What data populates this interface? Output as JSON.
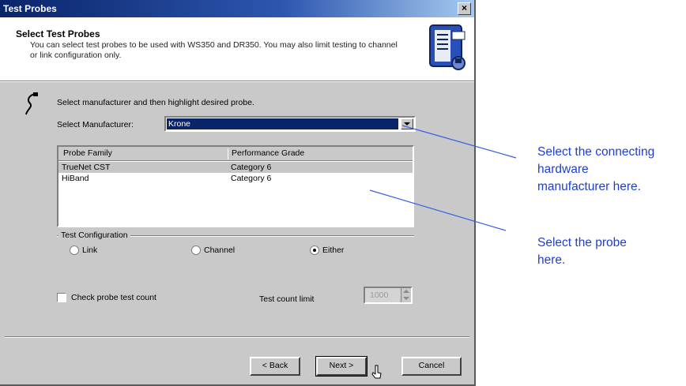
{
  "window": {
    "title": "Test Probes"
  },
  "header": {
    "title": "Select Test Probes",
    "description": "You can select test probes to be used with WS350 and DR350. You may also limit testing to channel or link configuration only."
  },
  "instruction": "Select manufacturer and then highlight desired probe.",
  "manufacturer": {
    "label": "Select Manufacturer:",
    "value": "Krone"
  },
  "probe_list": {
    "columns": [
      "Probe Family",
      "Performance Grade"
    ],
    "rows": [
      {
        "family": "TrueNet CST",
        "grade": "Category 6",
        "selected": true
      },
      {
        "family": "HiBand",
        "grade": "Category 6",
        "selected": false
      }
    ]
  },
  "test_configuration": {
    "label": "Test Configuration",
    "options": [
      {
        "label": "Link",
        "selected": false
      },
      {
        "label": "Channel",
        "selected": false
      },
      {
        "label": "Either",
        "selected": true
      }
    ]
  },
  "probe_count": {
    "checkbox_label": "Check probe test count",
    "checked": false,
    "limit_label": "Test count limit",
    "limit_value": "1000"
  },
  "buttons": {
    "back": "< Back",
    "next": "Next >",
    "cancel": "Cancel"
  },
  "callouts": {
    "manufacturer": [
      "Select the connecting",
      "hardware",
      "manufacturer here."
    ],
    "probe": [
      "Select the probe",
      "here."
    ]
  },
  "colors": {
    "callout": "#1f3fd0",
    "title_bar": "#0a246a",
    "selection": "#0a246a"
  }
}
